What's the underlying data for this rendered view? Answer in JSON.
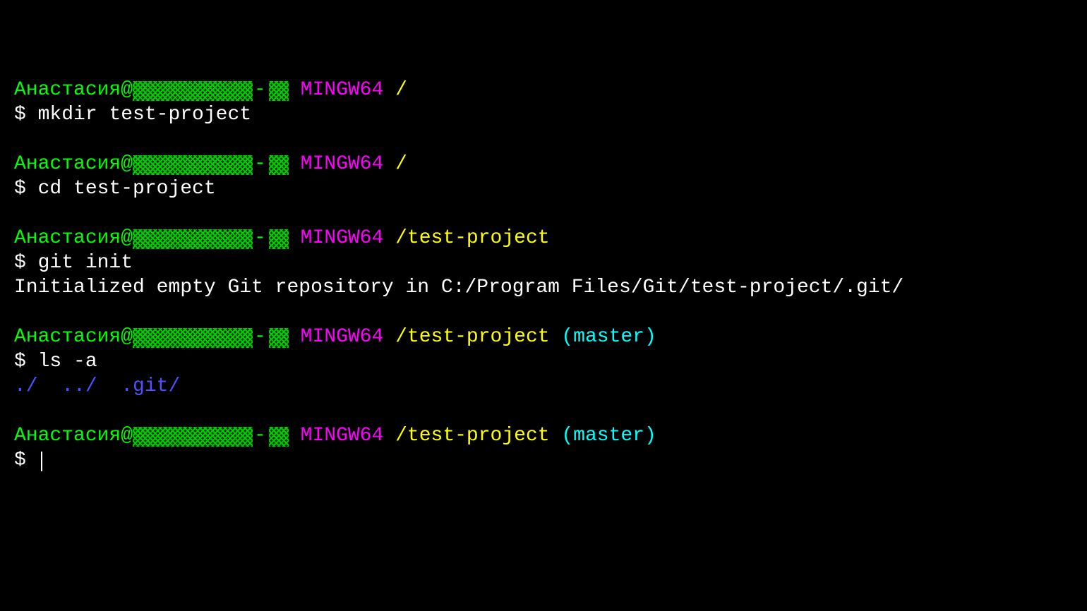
{
  "colors": {
    "user_host": "#00ff00",
    "system": "#ff00ff",
    "path": "#ffff00",
    "branch": "#00ffff",
    "output_dir": "#5050ff"
  },
  "prompt_symbol": "$ ",
  "username": "Анастасия",
  "at_sign": "@",
  "separator": "-",
  "system": "MINGW64",
  "blocks": [
    {
      "path": "/",
      "branch": null,
      "command": "mkdir test-project",
      "output": []
    },
    {
      "path": "/",
      "branch": null,
      "command": "cd test-project",
      "output": []
    },
    {
      "path": "/test-project",
      "branch": null,
      "command": "git init",
      "output": [
        {
          "type": "plain",
          "text": "Initialized empty Git repository in C:/Program Files/Git/test-project/.git/"
        }
      ]
    },
    {
      "path": "/test-project",
      "branch": "(master)",
      "command": "ls -a",
      "output": [
        {
          "type": "dirs",
          "items": [
            "./",
            "../",
            ".git/"
          ]
        }
      ]
    },
    {
      "path": "/test-project",
      "branch": "(master)",
      "command": "",
      "output": [],
      "cursor": true
    }
  ]
}
